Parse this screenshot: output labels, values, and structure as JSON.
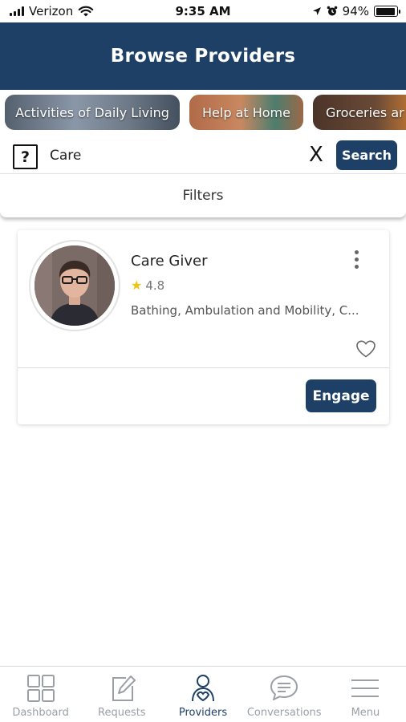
{
  "status_bar": {
    "carrier": "Verizon",
    "time": "9:35 AM",
    "battery": "94%",
    "battery_level": 0.94
  },
  "header": {
    "title": "Browse Providers"
  },
  "categories": [
    {
      "label": "Activities of Daily Living"
    },
    {
      "label": "Help at Home"
    },
    {
      "label": "Groceries ar"
    }
  ],
  "search": {
    "help_glyph": "?",
    "value": "Care",
    "clear_label": "X",
    "button_label": "Search"
  },
  "filters": {
    "label": "Filters"
  },
  "provider": {
    "name": "Care Giver",
    "rating": "4.8",
    "services": "Bathing, Ambulation and Mobility, C...",
    "engage_label": "Engage"
  },
  "tabs": [
    {
      "label": "Dashboard",
      "icon": "grid-icon"
    },
    {
      "label": "Requests",
      "icon": "edit-icon"
    },
    {
      "label": "Providers",
      "icon": "providers-icon",
      "active": true
    },
    {
      "label": "Conversations",
      "icon": "chat-icon"
    },
    {
      "label": "Menu",
      "icon": "menu-icon"
    }
  ],
  "colors": {
    "brand": "#1e3f66",
    "star": "#f2c40e"
  }
}
